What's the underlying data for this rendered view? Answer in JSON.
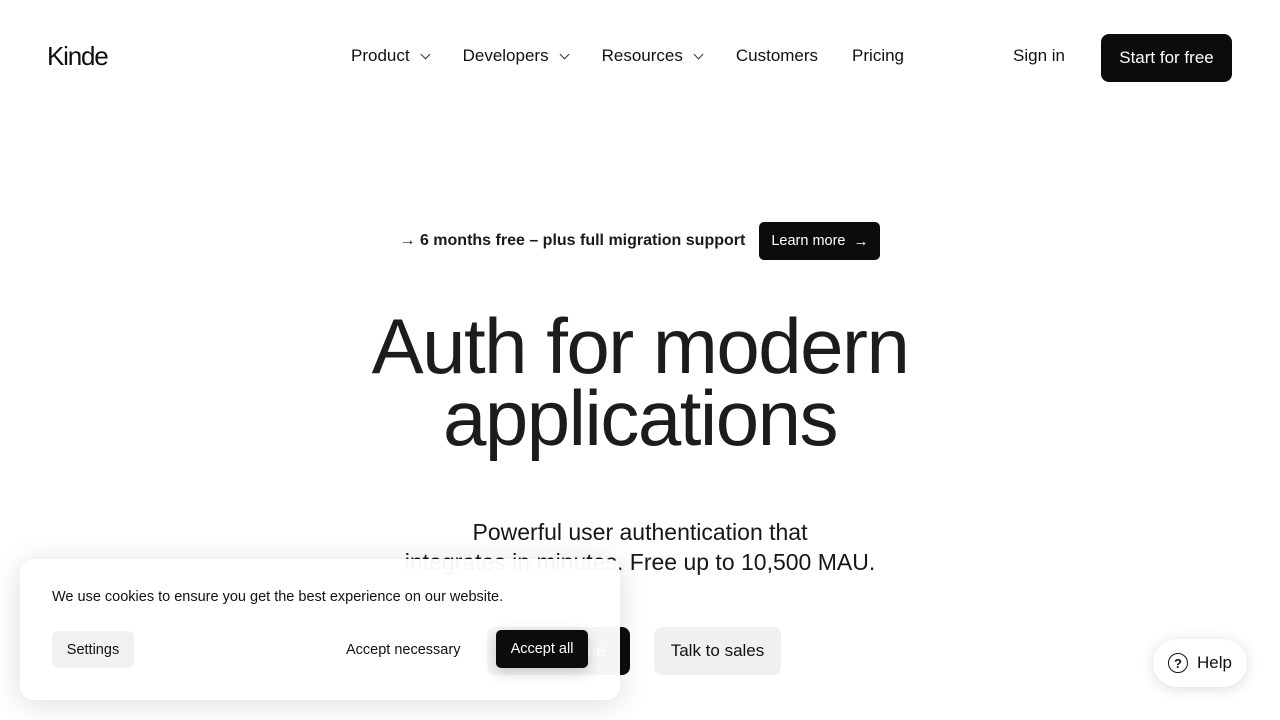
{
  "nav": {
    "logo": "Kinde",
    "links": [
      {
        "label": "Product",
        "has_dropdown": true
      },
      {
        "label": "Developers",
        "has_dropdown": true
      },
      {
        "label": "Resources",
        "has_dropdown": true
      },
      {
        "label": "Customers",
        "has_dropdown": false
      },
      {
        "label": "Pricing",
        "has_dropdown": false
      }
    ],
    "sign_in": "Sign in",
    "start_free": "Start for free"
  },
  "promo": {
    "text": "→ 6 months free – plus full migration support",
    "button_label": "Learn more",
    "button_icon": "→"
  },
  "hero": {
    "title_line1": "Auth for modern",
    "title_line2": "applications",
    "subtitle_line1": "Powerful user authentication that",
    "subtitle_line2": "integrates in minutes. Free up to 10,500 MAU.",
    "primary_cta": "Start for free",
    "secondary_cta": "Talk to sales"
  },
  "cookie_banner": {
    "message": "We use cookies to ensure you get the best experience on our website.",
    "settings": "Settings",
    "accept_necessary": "Accept necessary",
    "accept_all": "Accept all"
  },
  "help": {
    "icon": "?",
    "label": "Help"
  },
  "colors": {
    "primary": "#0c0c0c",
    "secondary_bg": "#f0f0f0",
    "text": "#111111"
  }
}
